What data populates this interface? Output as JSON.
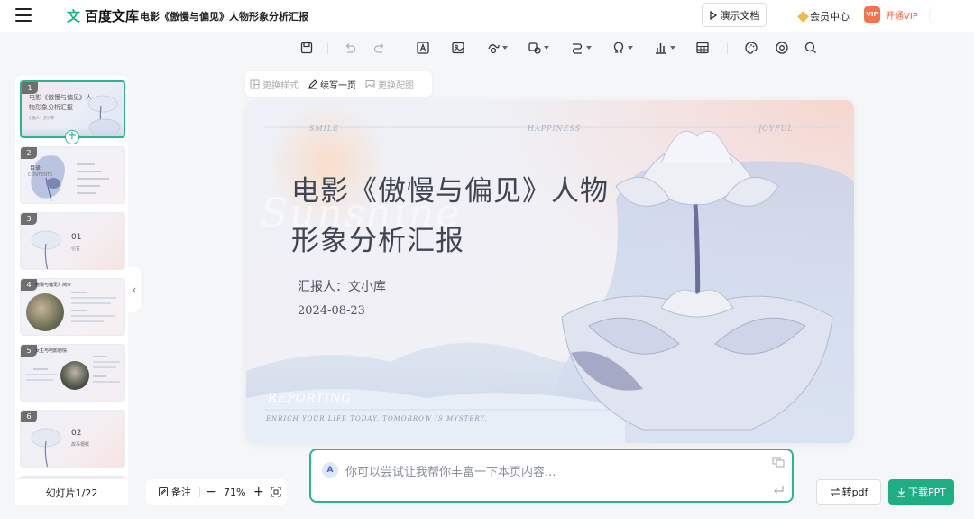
{
  "app": {
    "logo_mark": "文",
    "logo_text": "百度文库",
    "doc_title": "电影《傲慢与偏见》人物形象分析汇报"
  },
  "header": {
    "present_label": "演示文档",
    "member_label": "会员中心",
    "vip_badge": "VIP",
    "vip_label": "开通VIP"
  },
  "toolbar": {
    "items": [
      "save-icon",
      "undo-icon",
      "redo-icon",
      "textbox-icon",
      "image-icon",
      "shape-icon",
      "element-icon",
      "connector-icon",
      "symbol-icon",
      "chart-icon",
      "table-icon",
      "theme-icon",
      "animation-icon",
      "search-icon"
    ]
  },
  "context_toolbar": {
    "change_style": "更换样式",
    "continue_page": "续写一页",
    "change_image": "更换配图"
  },
  "slide": {
    "title": "电影《傲慢与偏见》人物形象分析汇报",
    "reporter": "汇报人：文小库",
    "date": "2024-08-23",
    "deco_smile": "SMILE",
    "deco_happiness": "HAPPINESS",
    "deco_joyful": "JOYFUL",
    "deco_sunshine": "Sunshine",
    "deco_reporting": "REPORTING",
    "deco_enrich": "ENRICH YOUR LIFE TODAY. TOMORROW IS MYSTERY."
  },
  "thumbnails": [
    {
      "num": "1",
      "text1": "电影《傲慢与偏见》人",
      "text2": "物形象分析汇报",
      "text3": "汇报人：文小库"
    },
    {
      "num": "2",
      "text1": "目录",
      "text2": "CONTENTS"
    },
    {
      "num": "3",
      "text1": "01",
      "text2": "引言"
    },
    {
      "num": "4",
      "text1": "傲慢与偏见》简介"
    },
    {
      "num": "5",
      "text1": "女主与电影剧情"
    },
    {
      "num": "6",
      "text1": "02",
      "text2": "故事梗概"
    }
  ],
  "sidebar": {
    "slide_count": "幻灯片1/22"
  },
  "assistant": {
    "placeholder": "你可以尝试让我帮你丰富一下本页内容...",
    "icon_label": "A"
  },
  "zoom": {
    "notes_label": "备注",
    "level": "71%"
  },
  "actions": {
    "to_pdf": "转pdf",
    "download": "下载PPT"
  }
}
